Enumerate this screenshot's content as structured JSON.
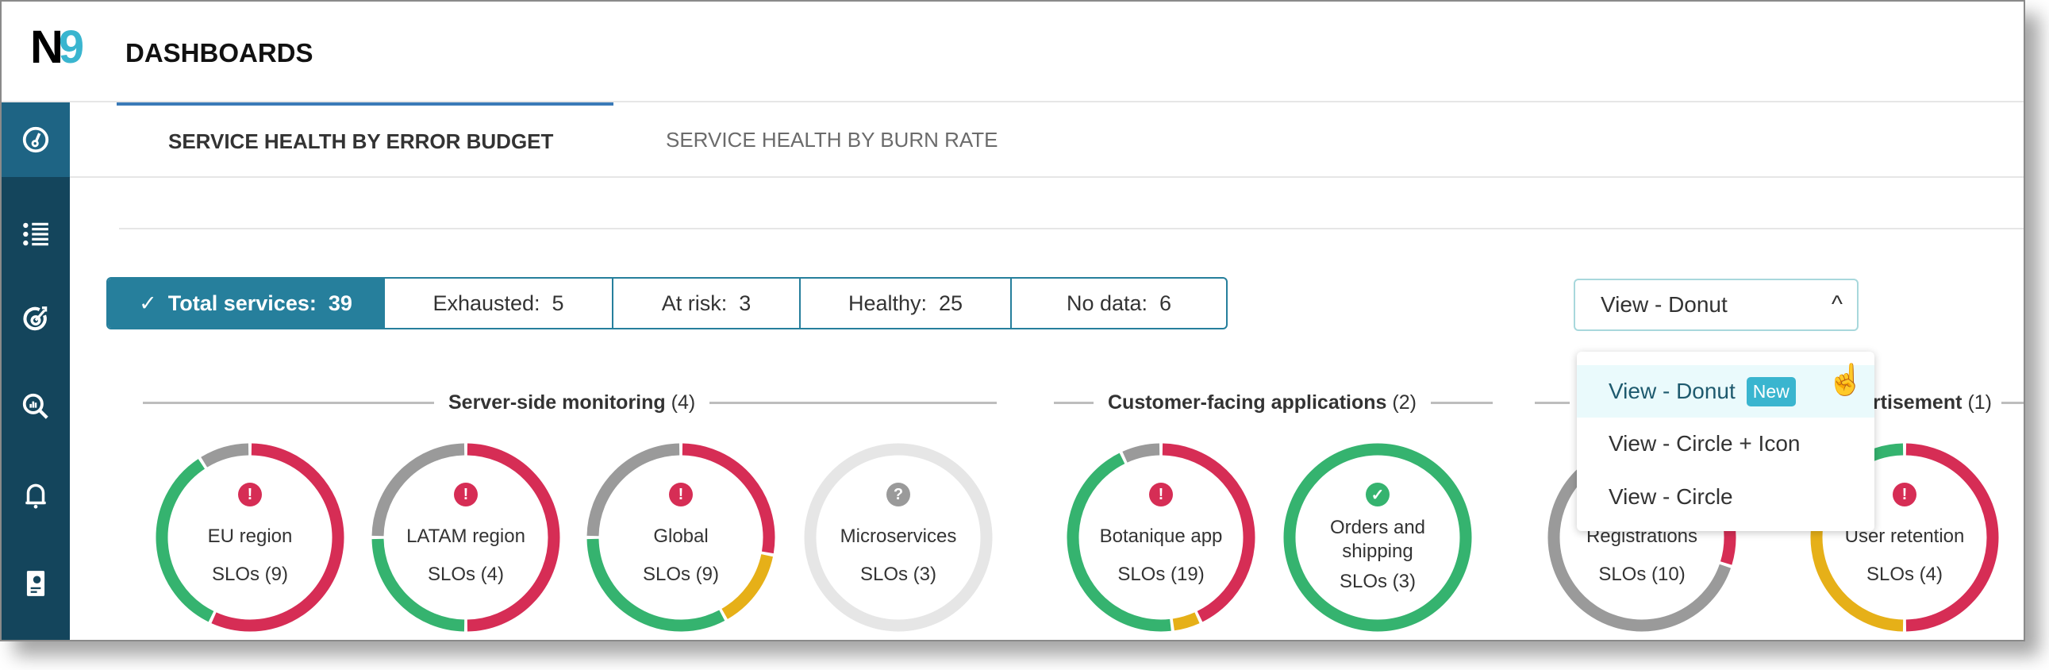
{
  "header": {
    "logo": "N9",
    "title": "DASHBOARDS"
  },
  "sidebar": {
    "items": [
      {
        "icon": "gauge-icon",
        "active": true
      },
      {
        "icon": "list-icon"
      },
      {
        "icon": "target-icon"
      },
      {
        "icon": "search-analytics-icon"
      },
      {
        "icon": "bell-icon"
      },
      {
        "icon": "report-icon"
      }
    ]
  },
  "tabs": [
    {
      "label": "SERVICE HEALTH BY ERROR BUDGET",
      "active": true
    },
    {
      "label": "SERVICE HEALTH BY BURN RATE"
    }
  ],
  "filters": {
    "total": "Total services:  39",
    "exhausted": "Exhausted:  5",
    "at_risk": "At risk:  3",
    "healthy": "Healthy:  25",
    "no_data": "No data:  6"
  },
  "view_select": {
    "value": "View - Donut",
    "options": [
      "View - Donut",
      "View - Circle + Icon",
      "View - Circle"
    ],
    "badge": "New"
  },
  "colors": {
    "exhausted": "#d62d55",
    "healthy": "#35b36f",
    "no_data": "#9a9a9a",
    "at_risk": "#e6b018",
    "empty": "#e6e6e6",
    "accent": "#267f9c"
  },
  "groups": [
    {
      "title": "Server-side monitoring",
      "count": "(4)"
    },
    {
      "title": "Customer-facing applications",
      "count": "(2)"
    },
    {
      "title": "Advertisement",
      "count": "(1)"
    }
  ],
  "services": [
    {
      "name": "EU region",
      "slos": "SLOs (9)",
      "status": "exhausted",
      "segments": [
        [
          "exhausted",
          0.57
        ],
        [
          "healthy",
          0.34
        ],
        [
          "no_data",
          0.09
        ]
      ]
    },
    {
      "name": "LATAM region",
      "slos": "SLOs (4)",
      "status": "exhausted",
      "segments": [
        [
          "exhausted",
          0.5
        ],
        [
          "healthy",
          0.25
        ],
        [
          "no_data",
          0.25
        ]
      ]
    },
    {
      "name": "Global",
      "slos": "SLOs (9)",
      "status": "exhausted",
      "segments": [
        [
          "exhausted",
          0.28
        ],
        [
          "at_risk",
          0.14
        ],
        [
          "healthy",
          0.33
        ],
        [
          "no_data",
          0.25
        ]
      ]
    },
    {
      "name": "Microservices",
      "slos": "SLOs (3)",
      "status": "no_data",
      "segments": [
        [
          "empty",
          1
        ]
      ]
    },
    {
      "name": "Botanique app",
      "slos": "SLOs (19)",
      "status": "exhausted",
      "segments": [
        [
          "exhausted",
          0.43
        ],
        [
          "at_risk",
          0.05
        ],
        [
          "healthy",
          0.45
        ],
        [
          "no_data",
          0.07
        ]
      ]
    },
    {
      "name": "Orders and shipping",
      "slos": "SLOs (3)",
      "status": "healthy",
      "segments": [
        [
          "healthy",
          1
        ]
      ]
    },
    {
      "name": "Registrations",
      "slos": "SLOs (10)",
      "status": "no_data",
      "segments": [
        [
          "exhausted",
          0.3
        ],
        [
          "no_data",
          0.7
        ]
      ]
    },
    {
      "name": "User retention",
      "slos": "SLOs (4)",
      "status": "exhausted",
      "segments": [
        [
          "exhausted",
          0.5
        ],
        [
          "at_risk",
          0.3
        ],
        [
          "healthy",
          0.2
        ]
      ]
    }
  ]
}
